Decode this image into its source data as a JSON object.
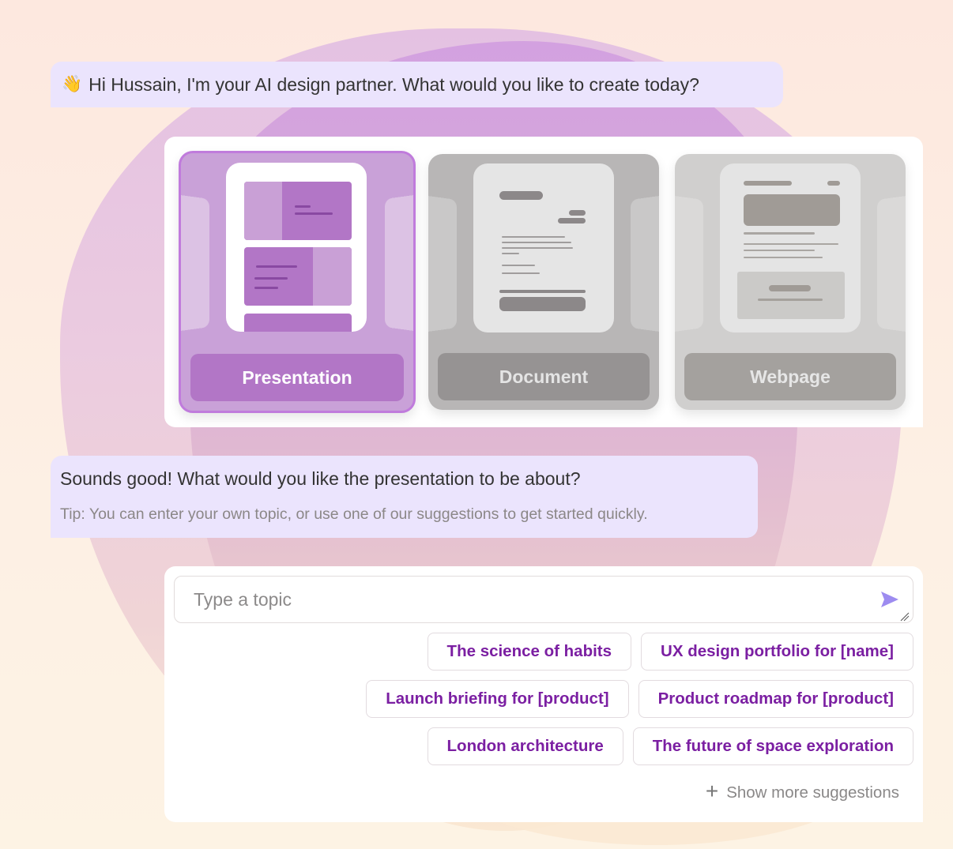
{
  "greeting": {
    "icon": "waving-hand-icon",
    "emoji": "👋",
    "text": "Hi Hussain, I'm your AI design partner. What would you like to create today?"
  },
  "picker": {
    "selected": "Presentation",
    "options": [
      {
        "label": "Presentation",
        "icon": "presentation-preview-icon"
      },
      {
        "label": "Document",
        "icon": "document-preview-icon"
      },
      {
        "label": "Webpage",
        "icon": "webpage-preview-icon"
      }
    ]
  },
  "followup": {
    "question": "Sounds good! What would you like the presentation to be about?",
    "tip": "Tip: You can enter your own topic, or use one of our suggestions to get started quickly."
  },
  "compose": {
    "value": "",
    "placeholder": "Type a topic",
    "send_icon": "send-icon",
    "suggestions": [
      [
        "The science of habits",
        "UX design portfolio for [name]"
      ],
      [
        "Launch briefing for [product]",
        "Product roadmap for [product]"
      ],
      [
        "London architecture",
        "The future of space exploration"
      ]
    ],
    "more_label": "Show more suggestions",
    "more_icon": "plus-icon"
  },
  "colors": {
    "accent": "#7b1fa2",
    "send": "#9d8cf0",
    "bubble": "#ebe4fd",
    "selected_card": "#b276c6"
  }
}
